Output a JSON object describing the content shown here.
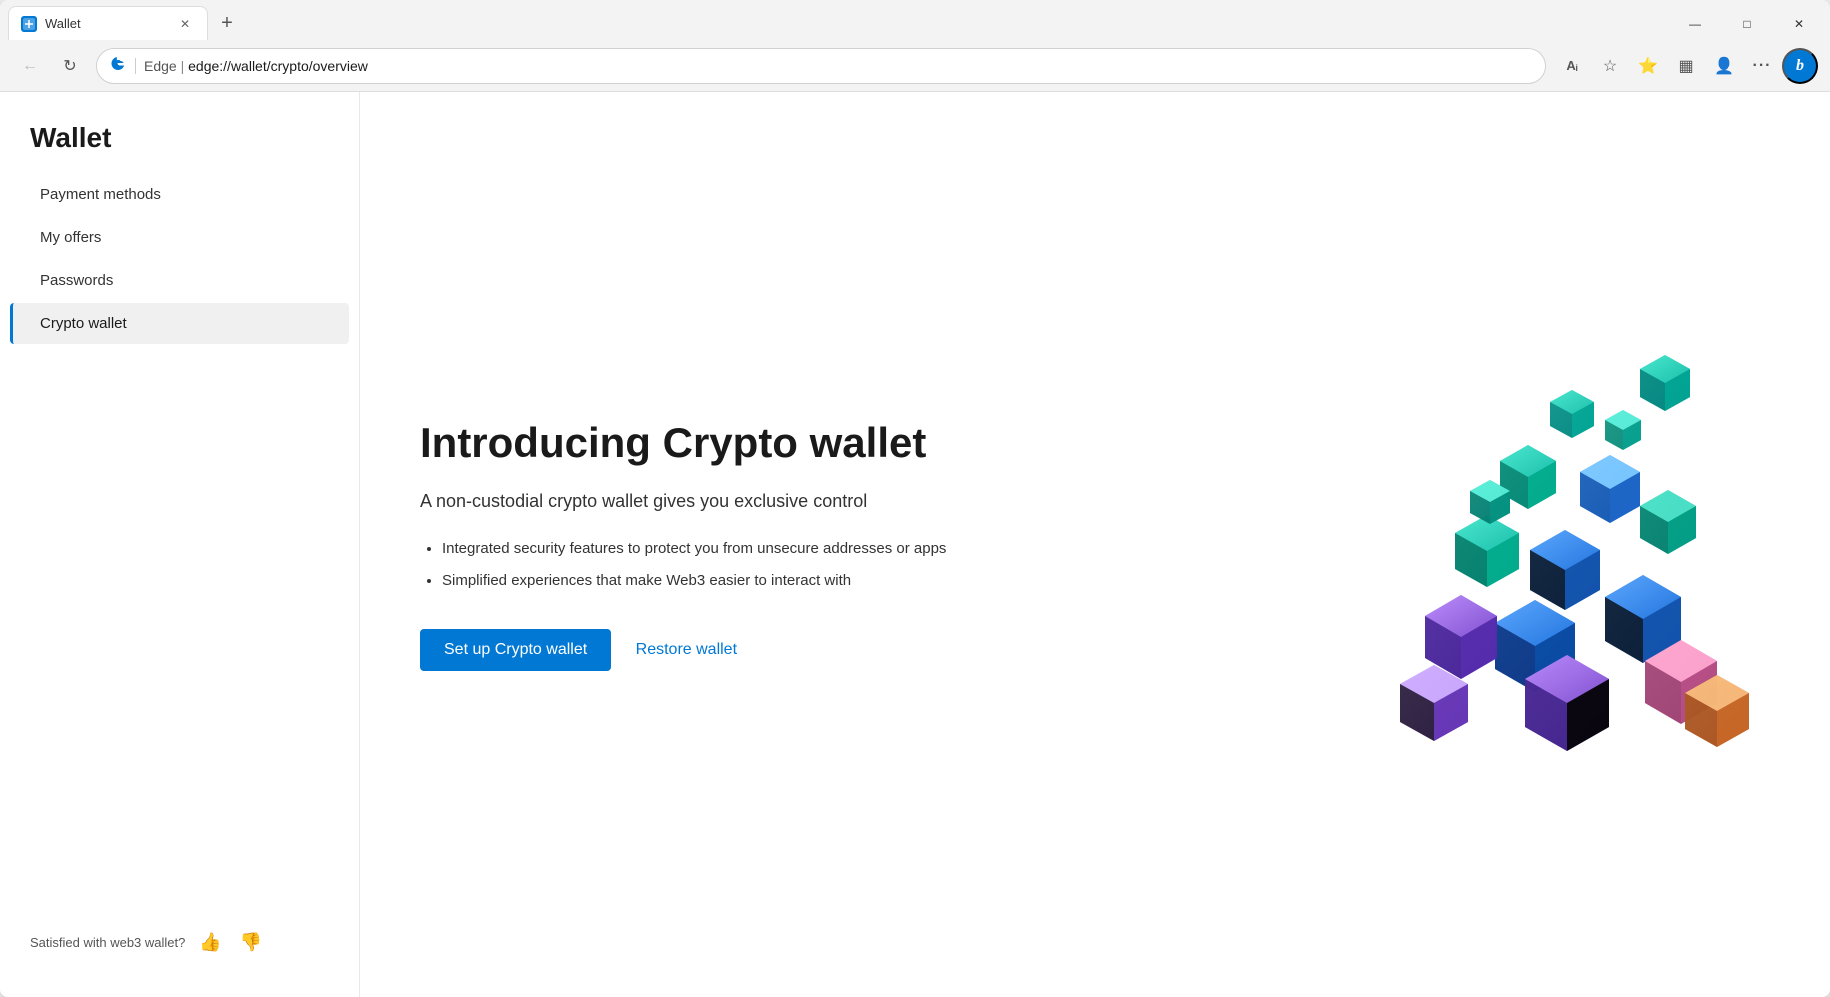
{
  "browser": {
    "tab_title": "Wallet",
    "tab_new_label": "+",
    "address_bar": {
      "protocol": "edge://",
      "path": "wallet/crypto/overview",
      "display": "edge://wallet/crypto/overview",
      "edge_label": "Edge"
    },
    "window_controls": {
      "minimize": "—",
      "maximize": "□",
      "close": "✕"
    }
  },
  "sidebar": {
    "title": "Wallet",
    "nav_items": [
      {
        "id": "payment-methods",
        "label": "Payment methods",
        "active": false
      },
      {
        "id": "my-offers",
        "label": "My offers",
        "active": false
      },
      {
        "id": "passwords",
        "label": "Passwords",
        "active": false
      },
      {
        "id": "crypto-wallet",
        "label": "Crypto wallet",
        "active": true
      }
    ],
    "feedback": {
      "label": "Satisfied with web3 wallet?",
      "thumbs_up": "👍",
      "thumbs_down": "👎"
    }
  },
  "main": {
    "heading": "Introducing Crypto wallet",
    "subtitle": "A non-custodial crypto wallet gives you exclusive control",
    "features": [
      "Integrated security features to protect you from unsecure addresses or apps",
      "Simplified experiences that make Web3 easier to interact with"
    ],
    "setup_button": "Set up Crypto wallet",
    "restore_button": "Restore wallet"
  },
  "toolbar": {
    "back_icon": "←",
    "refresh_icon": "↻",
    "read_aloud_icon": "Aᵢ",
    "favorites_star_icon": "☆",
    "add_favorites_icon": "★",
    "collections_icon": "▦",
    "profile_icon": "👤",
    "more_icon": "···",
    "bing_label": "b"
  }
}
